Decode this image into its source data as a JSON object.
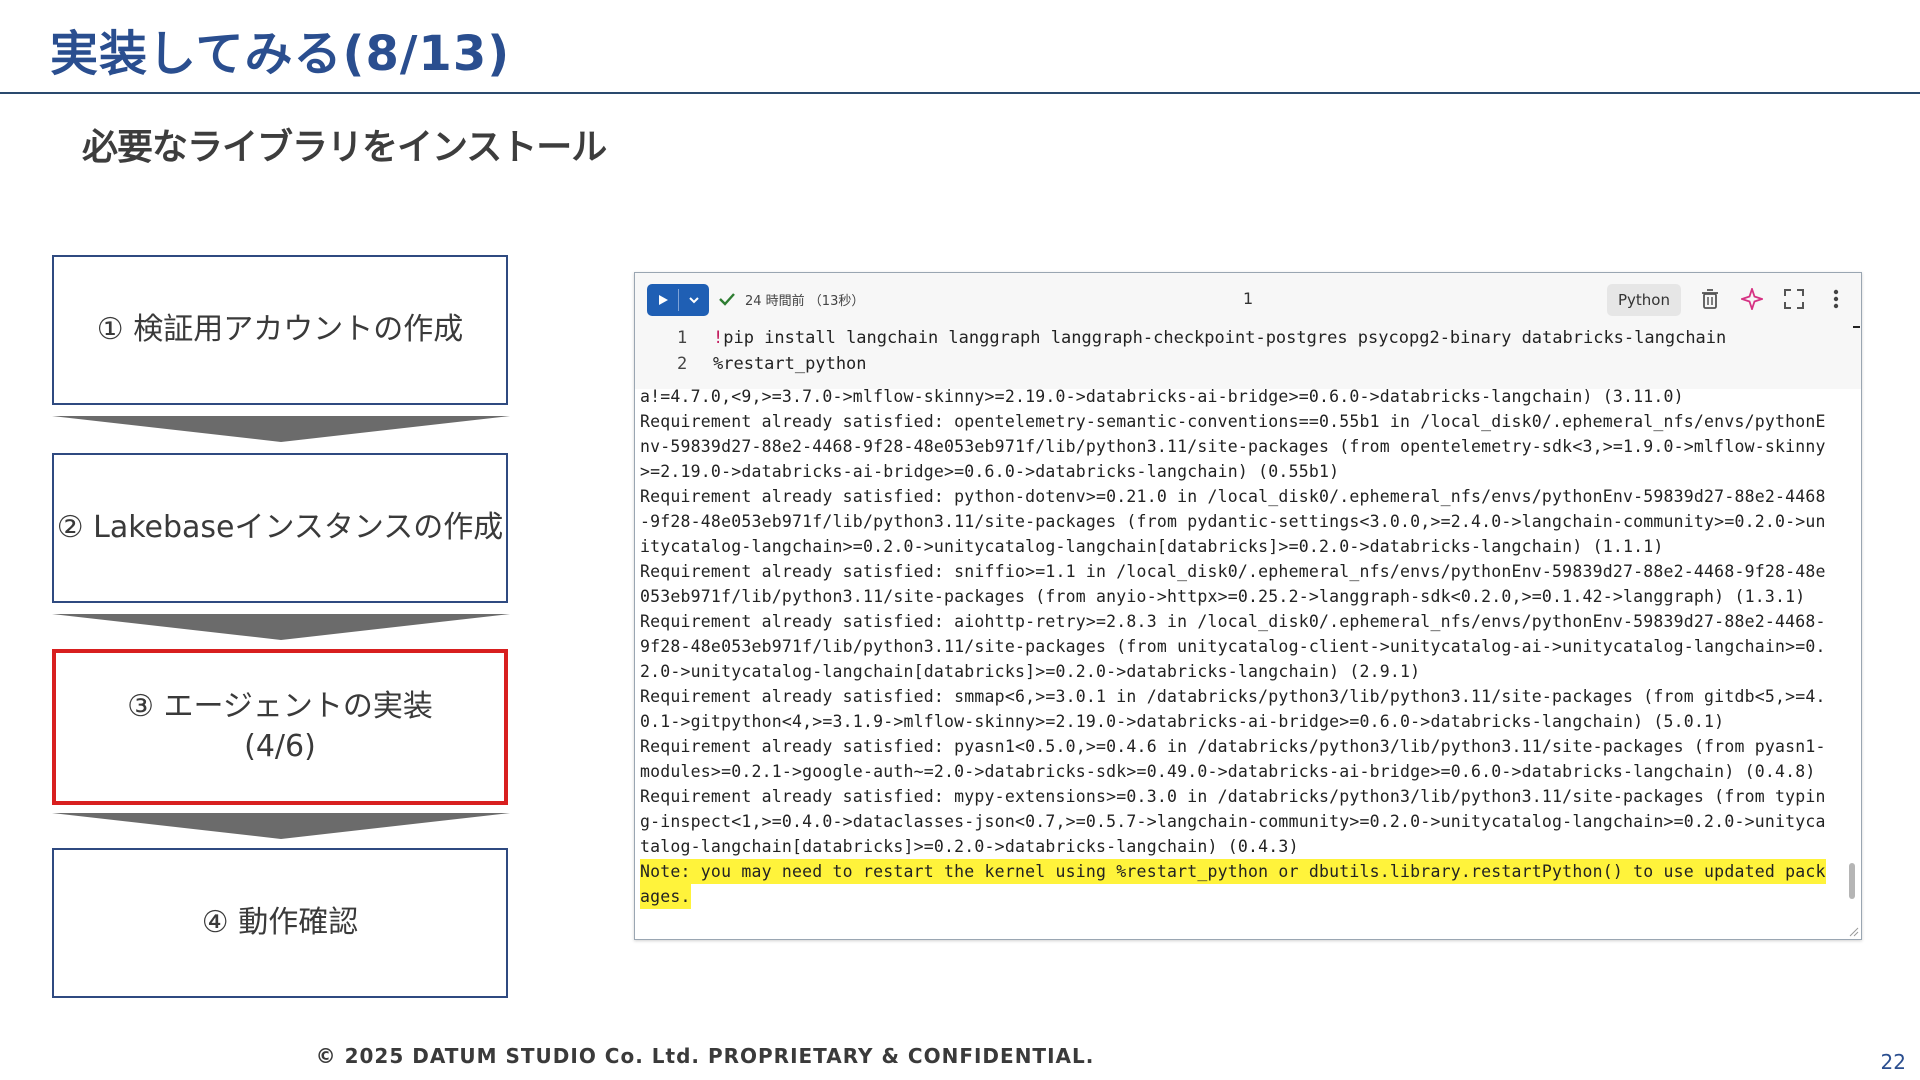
{
  "header": {
    "title": "実装してみる(8/13)",
    "subtitle": "必要なライブラリをインストール"
  },
  "steps": [
    {
      "label": "① 検証用アカウントの作成",
      "sub": ""
    },
    {
      "label": "② Lakebaseインスタンスの作成",
      "sub": ""
    },
    {
      "label": "③ エージェントの実装",
      "sub": "(4/6)"
    },
    {
      "label": "④ 動作確認",
      "sub": ""
    }
  ],
  "colors": {
    "title": "#2a4e8f",
    "active_step_border": "#d81f1f",
    "step_border": "#2f4a80",
    "arrow": "#6b6b6b",
    "run_button": "#1f5fb4",
    "highlight": "#fff33b"
  },
  "notebook": {
    "run_status": "24 時間前 （13秒）",
    "cell_number": "1",
    "language": "Python",
    "icons": [
      "play-icon",
      "chevron-down-icon",
      "check-icon",
      "trash-icon",
      "sparkle-icon",
      "fullscreen-icon",
      "more-vert-icon"
    ],
    "code": [
      {
        "no": "1",
        "bang": "!",
        "text": "pip install langchain langgraph langgraph-checkpoint-postgres psycopg2-binary databricks-langchain"
      },
      {
        "no": "2",
        "bang": "",
        "text": "%restart_python"
      }
    ],
    "output": [
      "a!=4.7.0,<9,>=3.7.0->mlflow-skinny>=2.19.0->databricks-ai-bridge>=0.6.0->databricks-langchain) (3.11.0)",
      "Requirement already satisfied: opentelemetry-semantic-conventions==0.55b1 in /local_disk0/.ephemeral_nfs/envs/pythonE",
      "nv-59839d27-88e2-4468-9f28-48e053eb971f/lib/python3.11/site-packages (from opentelemetry-sdk<3,>=1.9.0->mlflow-skinny",
      ">=2.19.0->databricks-ai-bridge>=0.6.0->databricks-langchain) (0.55b1)",
      "Requirement already satisfied: python-dotenv>=0.21.0 in /local_disk0/.ephemeral_nfs/envs/pythonEnv-59839d27-88e2-4468",
      "-9f28-48e053eb971f/lib/python3.11/site-packages (from pydantic-settings<3.0.0,>=2.4.0->langchain-community>=0.2.0->un",
      "itycatalog-langchain>=0.2.0->unitycatalog-langchain[databricks]>=0.2.0->databricks-langchain) (1.1.1)",
      "Requirement already satisfied: sniffio>=1.1 in /local_disk0/.ephemeral_nfs/envs/pythonEnv-59839d27-88e2-4468-9f28-48e",
      "053eb971f/lib/python3.11/site-packages (from anyio->httpx>=0.25.2->langgraph-sdk<0.2.0,>=0.1.42->langgraph) (1.3.1)",
      "Requirement already satisfied: aiohttp-retry>=2.8.3 in /local_disk0/.ephemeral_nfs/envs/pythonEnv-59839d27-88e2-4468-",
      "9f28-48e053eb971f/lib/python3.11/site-packages (from unitycatalog-client->unitycatalog-ai->unitycatalog-langchain>=0.",
      "2.0->unitycatalog-langchain[databricks]>=0.2.0->databricks-langchain) (2.9.1)",
      "Requirement already satisfied: smmap<6,>=3.0.1 in /databricks/python3/lib/python3.11/site-packages (from gitdb<5,>=4.",
      "0.1->gitpython<4,>=3.1.9->mlflow-skinny>=2.19.0->databricks-ai-bridge>=0.6.0->databricks-langchain) (5.0.1)",
      "Requirement already satisfied: pyasn1<0.5.0,>=0.4.6 in /databricks/python3/lib/python3.11/site-packages (from pyasn1-",
      "modules>=0.2.1->google-auth~=2.0->databricks-sdk>=0.49.0->databricks-ai-bridge>=0.6.0->databricks-langchain) (0.4.8)",
      "Requirement already satisfied: mypy-extensions>=0.3.0 in /databricks/python3/lib/python3.11/site-packages (from typin",
      "g-inspect<1,>=0.4.0->dataclasses-json<0.7,>=0.5.7->langchain-community>=0.2.0->unitycatalog-langchain>=0.2.0->unityca",
      "talog-langchain[databricks]>=0.2.0->databricks-langchain) (0.4.3)"
    ],
    "note": [
      "Note: you may need to restart the kernel using %restart_python or dbutils.library.restartPython() to use updated pack",
      "ages."
    ]
  },
  "footer": {
    "copyright": "© 2025 DATUM STUDIO Co. Ltd. PROPRIETARY & CONFIDENTIAL.",
    "page": "22"
  }
}
